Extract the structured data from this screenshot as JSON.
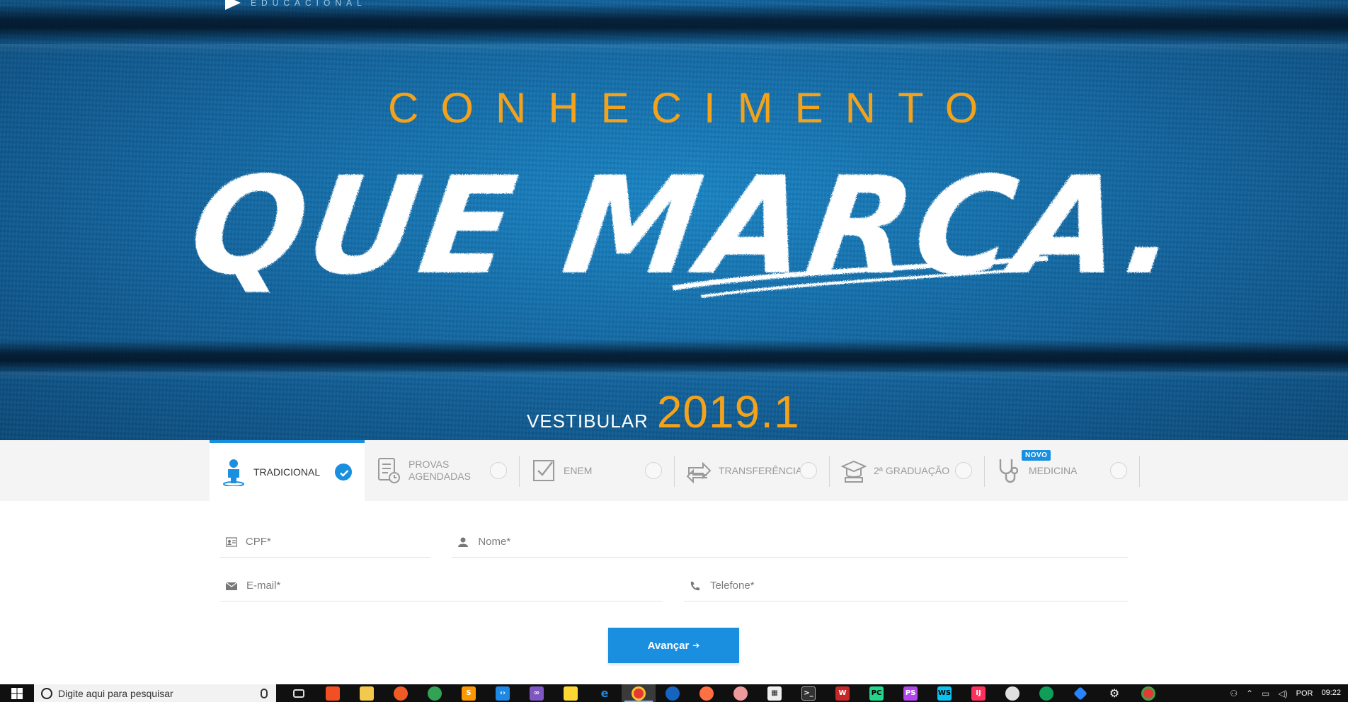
{
  "hero": {
    "logo_text": "EDUCACIONAL",
    "headline_top": "CONHECIMENTO",
    "headline_main": "QUE MARCA.",
    "vestibular_label": "VESTIBULAR",
    "vestibular_year": "2019.1",
    "colors": {
      "accent_orange": "#f5a21b",
      "background_blue": "#12639d"
    }
  },
  "tabs": [
    {
      "label": "TRADICIONAL",
      "icon": "person-pin-icon",
      "selected": true
    },
    {
      "label": "PROVAS\nAGENDADAS",
      "icon": "scheduled-exam-icon",
      "selected": false
    },
    {
      "label": "ENEM",
      "icon": "checkbox-icon",
      "selected": false
    },
    {
      "label": "TRANSFERÊNCIA",
      "icon": "transfer-arrows-icon",
      "selected": false
    },
    {
      "label": "2ª GRADUAÇÃO",
      "icon": "graduation-cap-icon",
      "selected": false
    },
    {
      "label": "MEDICINA",
      "icon": "stethoscope-icon",
      "selected": false,
      "badge": "NOVO"
    }
  ],
  "form": {
    "cpf_placeholder": "CPF*",
    "nome_placeholder": "Nome*",
    "email_placeholder": "E-mail*",
    "telefone_placeholder": "Telefone*",
    "submit_label": "Avançar",
    "accent": "#1a8fe0"
  },
  "taskbar": {
    "search_placeholder": "Digite aqui para pesquisar",
    "language": "POR",
    "time": "09:22",
    "apps": [
      "task-view-icon",
      "store-icon",
      "file-explorer-icon",
      "postman-icon",
      "gitkraken-icon",
      "sublime-icon",
      "vscode-icon",
      "visual-studio-icon",
      "notes-icon",
      "edge-icon",
      "chrome-icon",
      "firefox-dev-icon",
      "firefox-icon",
      "paint-icon",
      "calculator-icon",
      "terminal-icon",
      "winrar-icon",
      "pycharm-icon",
      "phpstorm-icon",
      "webstorm-icon",
      "intellij-icon",
      "clock-app-icon",
      "hangouts-icon",
      "sourcetree-icon",
      "settings-icon",
      "chrome-alt-icon"
    ]
  }
}
